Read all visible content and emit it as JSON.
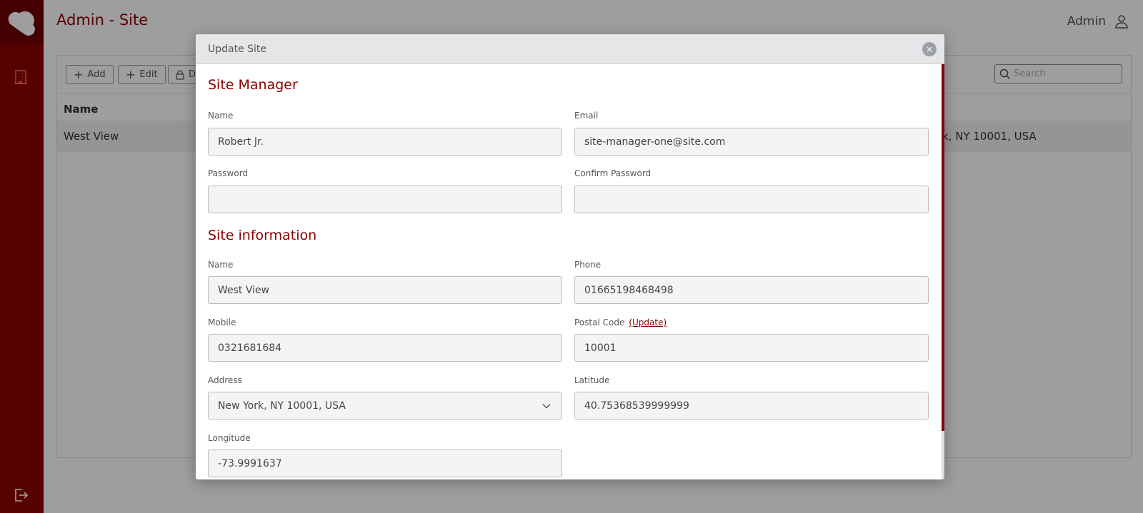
{
  "header": {
    "title": "Admin - Site",
    "user": "Admin"
  },
  "toolbar": {
    "add_label": "Add",
    "edit_label": "Edit",
    "third_label": "D",
    "search_placeholder": "Search"
  },
  "table": {
    "header_name": "Name",
    "row": {
      "name": "West View",
      "address_fragment": "k, NY 10001, USA"
    }
  },
  "modal": {
    "title": "Update Site",
    "close_glyph": "×",
    "manager_section": "Site Manager",
    "manager": {
      "name_label": "Name",
      "name_value": "Robert Jr.",
      "email_label": "Email",
      "email_value": "site-manager-one@site.com",
      "password_label": "Password",
      "password_value": "",
      "confirm_label": "Confirm Password",
      "confirm_value": ""
    },
    "info_section": "Site information",
    "site": {
      "name_label": "Name",
      "name_value": "West View",
      "phone_label": "Phone",
      "phone_value": "01665198468498",
      "mobile_label": "Mobile",
      "mobile_value": "0321681684",
      "postal_label": "Postal Code",
      "postal_link": "(Update)",
      "postal_value": "10001",
      "address_label": "Address",
      "address_value": "New York, NY 10001, USA",
      "latitude_label": "Latitude",
      "latitude_value": "40.75368539999999",
      "longitude_label": "Longitude",
      "longitude_value": "-73.9991637"
    }
  },
  "colors": {
    "brand": "#8b0000",
    "brand_dark": "#6e0000"
  },
  "icons": [
    "cloud-logo-icon",
    "building-icon",
    "logout-icon",
    "user-icon",
    "plus-icon",
    "lock-icon",
    "search-icon",
    "close-icon",
    "chevron-down-icon"
  ]
}
